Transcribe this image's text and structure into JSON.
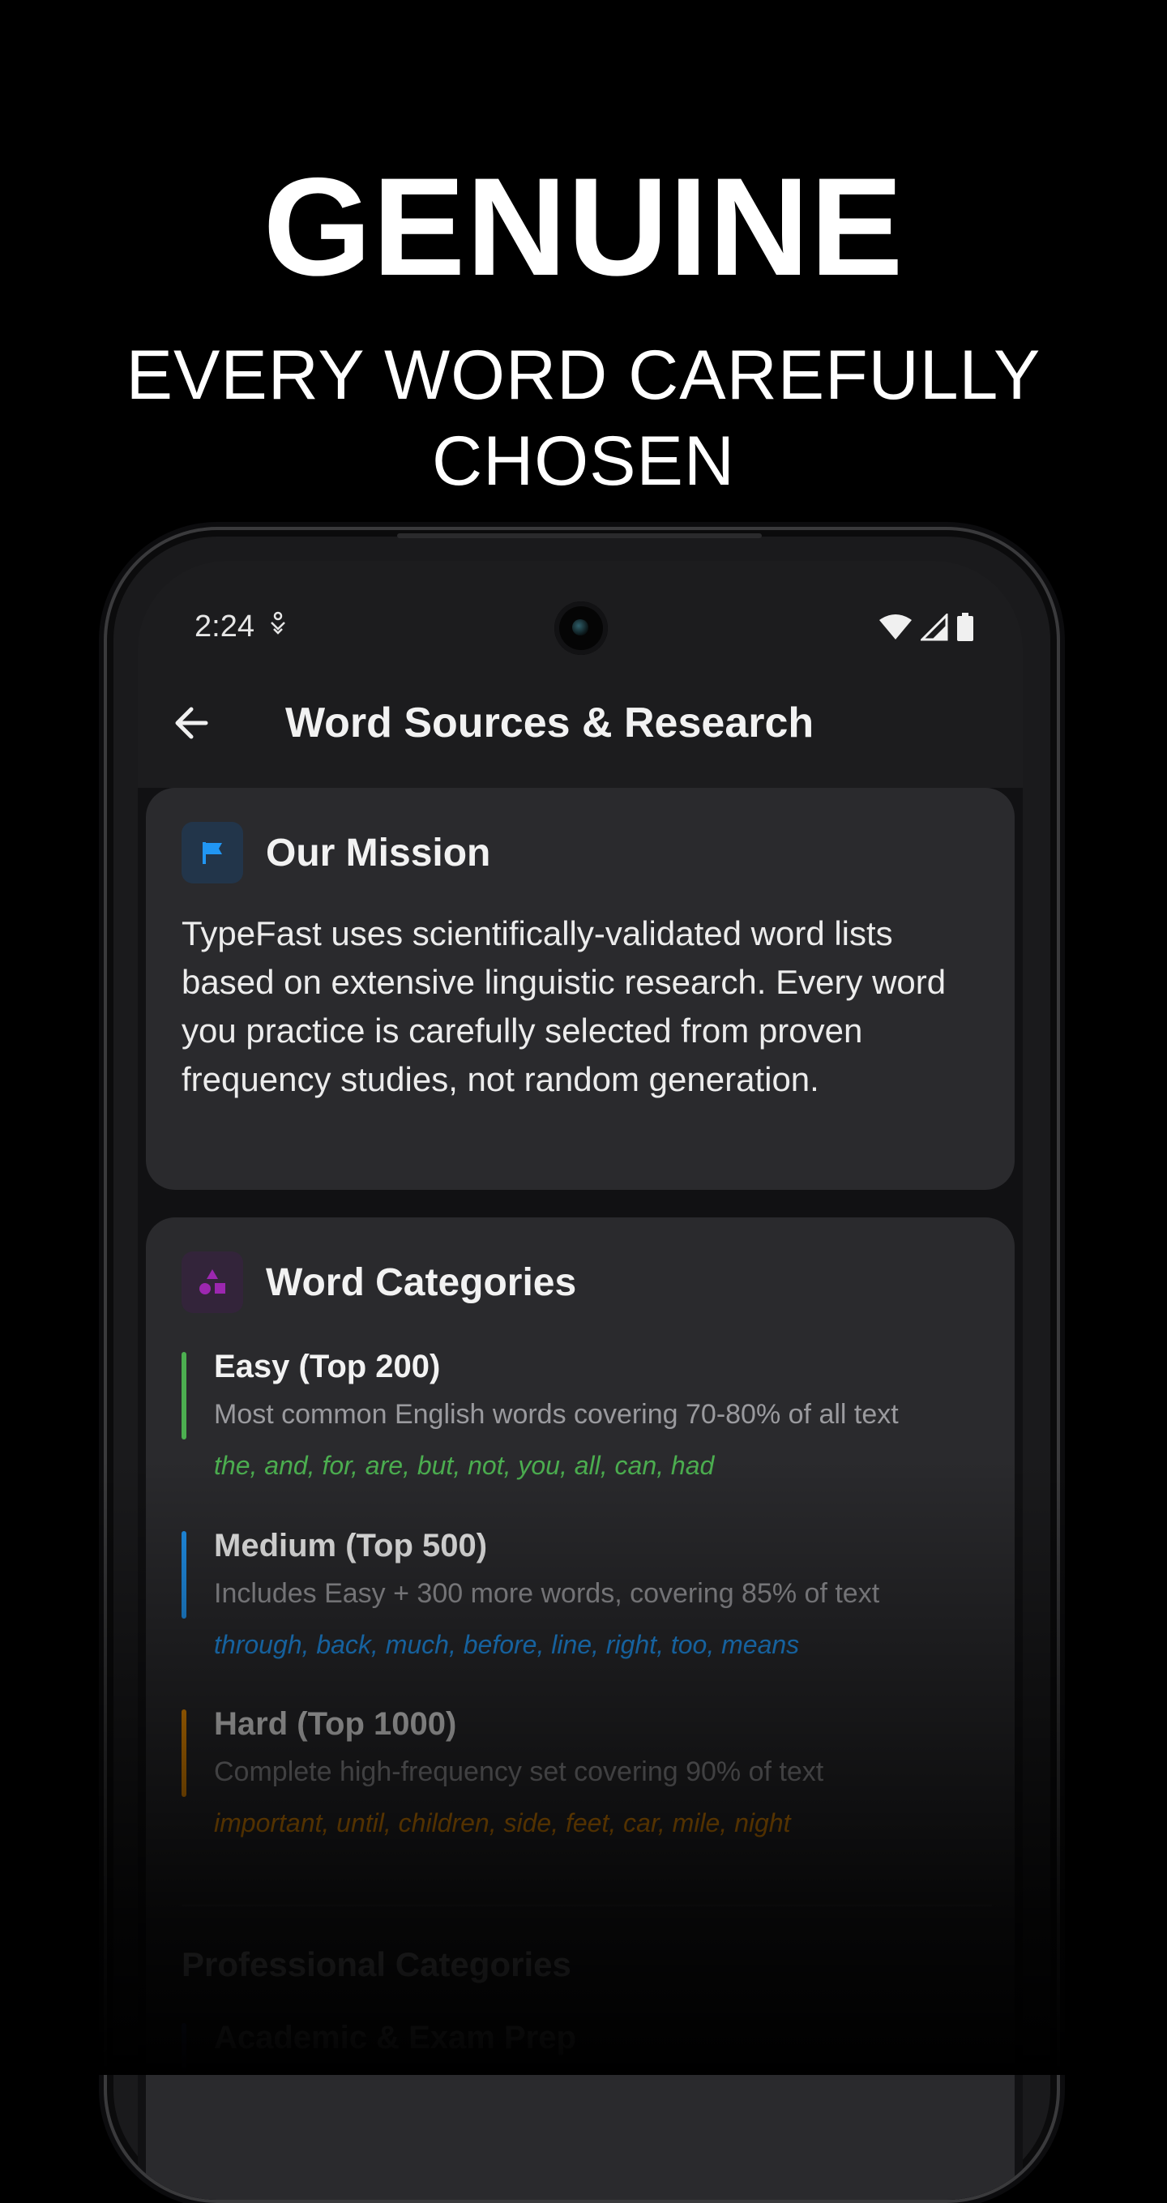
{
  "promo": {
    "headline": "GENUINE",
    "subline_1": "EVERY WORD CAREFULLY",
    "subline_2": "CHOSEN"
  },
  "status_bar": {
    "time": "2:24"
  },
  "appbar": {
    "title": "Word Sources & Research"
  },
  "mission": {
    "title": "Our Mission",
    "icon": "flag-icon",
    "text": "TypeFast uses scientifically-validated word lists based on extensive linguistic research. Every word you practice is carefully selected from proven frequency studies, not random generation."
  },
  "categories": {
    "title": "Word Categories",
    "icon": "shapes-icon",
    "items": [
      {
        "name": "Easy (Top 200)",
        "description": "Most common English words covering 70-80% of all text",
        "examples": "the, and, for, are, but, not, you, all, can, had",
        "color": "#4caf50"
      },
      {
        "name": "Medium (Top 500)",
        "description": "Includes Easy + 300 more words, covering 85% of text",
        "examples": "through, back, much, before, line, right, too, means",
        "color": "#2196f3"
      },
      {
        "name": "Hard (Top 1000)",
        "description": "Complete high-frequency set covering 90% of text",
        "examples": "important, until, children, side, feet, car, mile, night",
        "color": "#ff9800"
      }
    ]
  },
  "professional": {
    "title": "Professional Categories",
    "first_item": "Academic & Exam Prep"
  },
  "colors": {
    "background": "#000000",
    "card": "#2a2a2d",
    "accent_blue": "#2196f3",
    "accent_purple": "#9c27b0"
  }
}
